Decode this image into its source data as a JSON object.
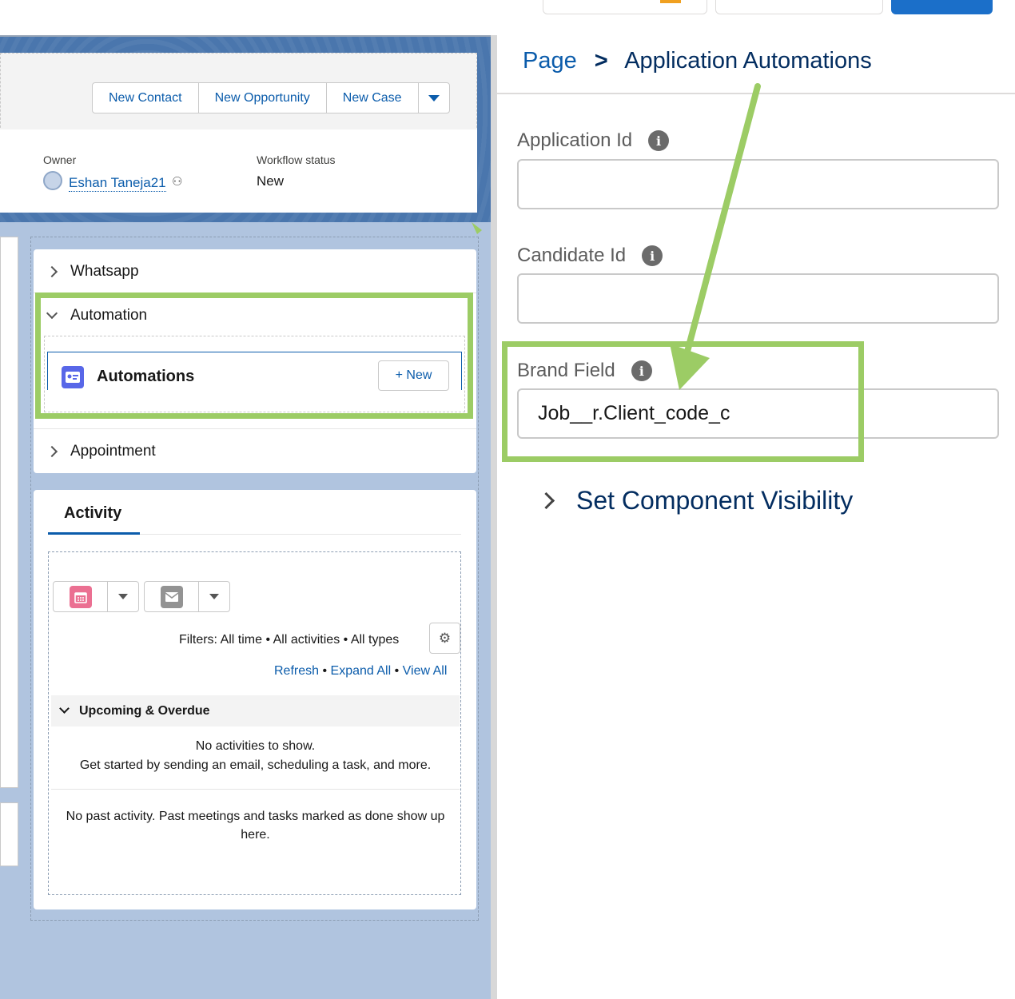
{
  "header": {
    "buttons": [
      "New Contact",
      "New Opportunity",
      "New Case"
    ],
    "owner_label": "Owner",
    "owner_name": "Eshan Taneja21",
    "status_label": "Workflow status",
    "status_value": "New"
  },
  "accordion": {
    "sections": [
      {
        "label": "Whatsapp",
        "expanded": false
      },
      {
        "label": "Automation",
        "expanded": true
      },
      {
        "label": "Appointment",
        "expanded": false
      }
    ],
    "automations_title": "Automations",
    "new_button": "+ New"
  },
  "activity": {
    "tab": "Activity",
    "filters": "Filters: All time • All activities • All types",
    "links": {
      "refresh": "Refresh",
      "expand_all": "Expand All",
      "view_all": "View All"
    },
    "upcoming_label": "Upcoming & Overdue",
    "empty_line1": "No activities to show.",
    "empty_line2": "Get started by sending an email, scheduling a task, and more.",
    "past_line1": "No past activity. Past meetings and tasks marked as done show up",
    "past_line2": "here."
  },
  "properties": {
    "breadcrumb_root": "Page",
    "breadcrumb_sep": ">",
    "breadcrumb_current": "Application Automations",
    "fields": [
      {
        "label": "Application Id",
        "value": ""
      },
      {
        "label": "Candidate Id",
        "value": ""
      },
      {
        "label": "Brand Field",
        "value": "Job__r.Client_code_c"
      }
    ],
    "visibility_label": "Set Component Visibility"
  },
  "colors": {
    "highlight": "#9ccc65",
    "link": "#0b5cab",
    "canvas": "#b0c4df"
  }
}
